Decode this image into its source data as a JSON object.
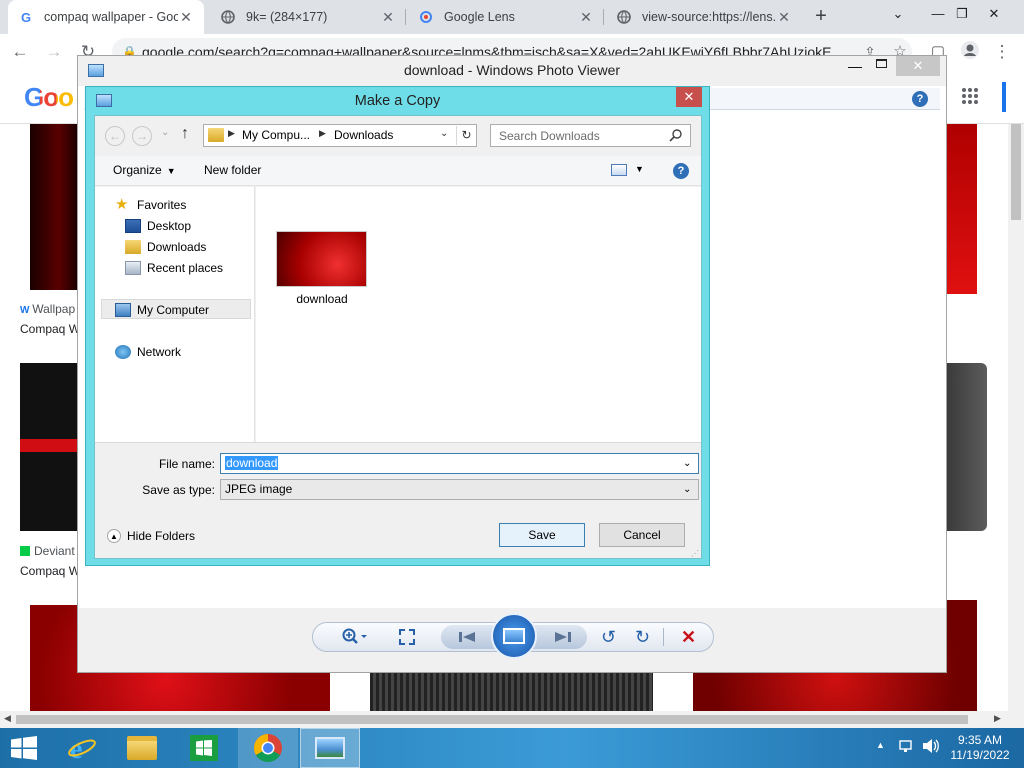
{
  "browser": {
    "tabs": [
      {
        "label": "compaq wallpaper - Goo",
        "favicon": "G"
      },
      {
        "label": "9k= (284×177)",
        "favicon": "globe"
      },
      {
        "label": "Google Lens",
        "favicon": "lens"
      },
      {
        "label": "view-source:https://lens.",
        "favicon": "globe"
      }
    ],
    "new_tab": "+",
    "url": "google.com/search?q=compaq+wallpaper&source=lnms&tbm=isch&sa=X&ved=2ahUKEwiY6fLBbbr7AhUziokE",
    "logo": "Goo",
    "results": [
      {
        "source": "Wallpap",
        "title": "Compaq W"
      },
      {
        "source": "Deviant",
        "title": "Compaq W"
      }
    ]
  },
  "photo_viewer": {
    "title": "download - Windows Photo Viewer"
  },
  "dialog": {
    "title": "Make a Copy",
    "breadcrumb": [
      "My Compu...",
      "Downloads"
    ],
    "search_placeholder": "Search Downloads",
    "organize": "Organize",
    "new_folder": "New folder",
    "favorites_label": "Favorites",
    "favorites": [
      "Desktop",
      "Downloads",
      "Recent places"
    ],
    "my_computer": "My Computer",
    "network": "Network",
    "file_item": "download",
    "file_name_label": "File name:",
    "file_name_value": "download",
    "save_type_label": "Save as type:",
    "save_type_value": "JPEG image",
    "hide_folders": "Hide Folders",
    "save": "Save",
    "cancel": "Cancel"
  },
  "taskbar": {
    "time": "9:35 AM",
    "date": "11/19/2022"
  },
  "colors": {
    "dialog_frame": "#6fdde8",
    "chrome_tabbar": "#dee1e6",
    "taskbar": "#2a86c3",
    "accent_red": "#c8101b"
  }
}
